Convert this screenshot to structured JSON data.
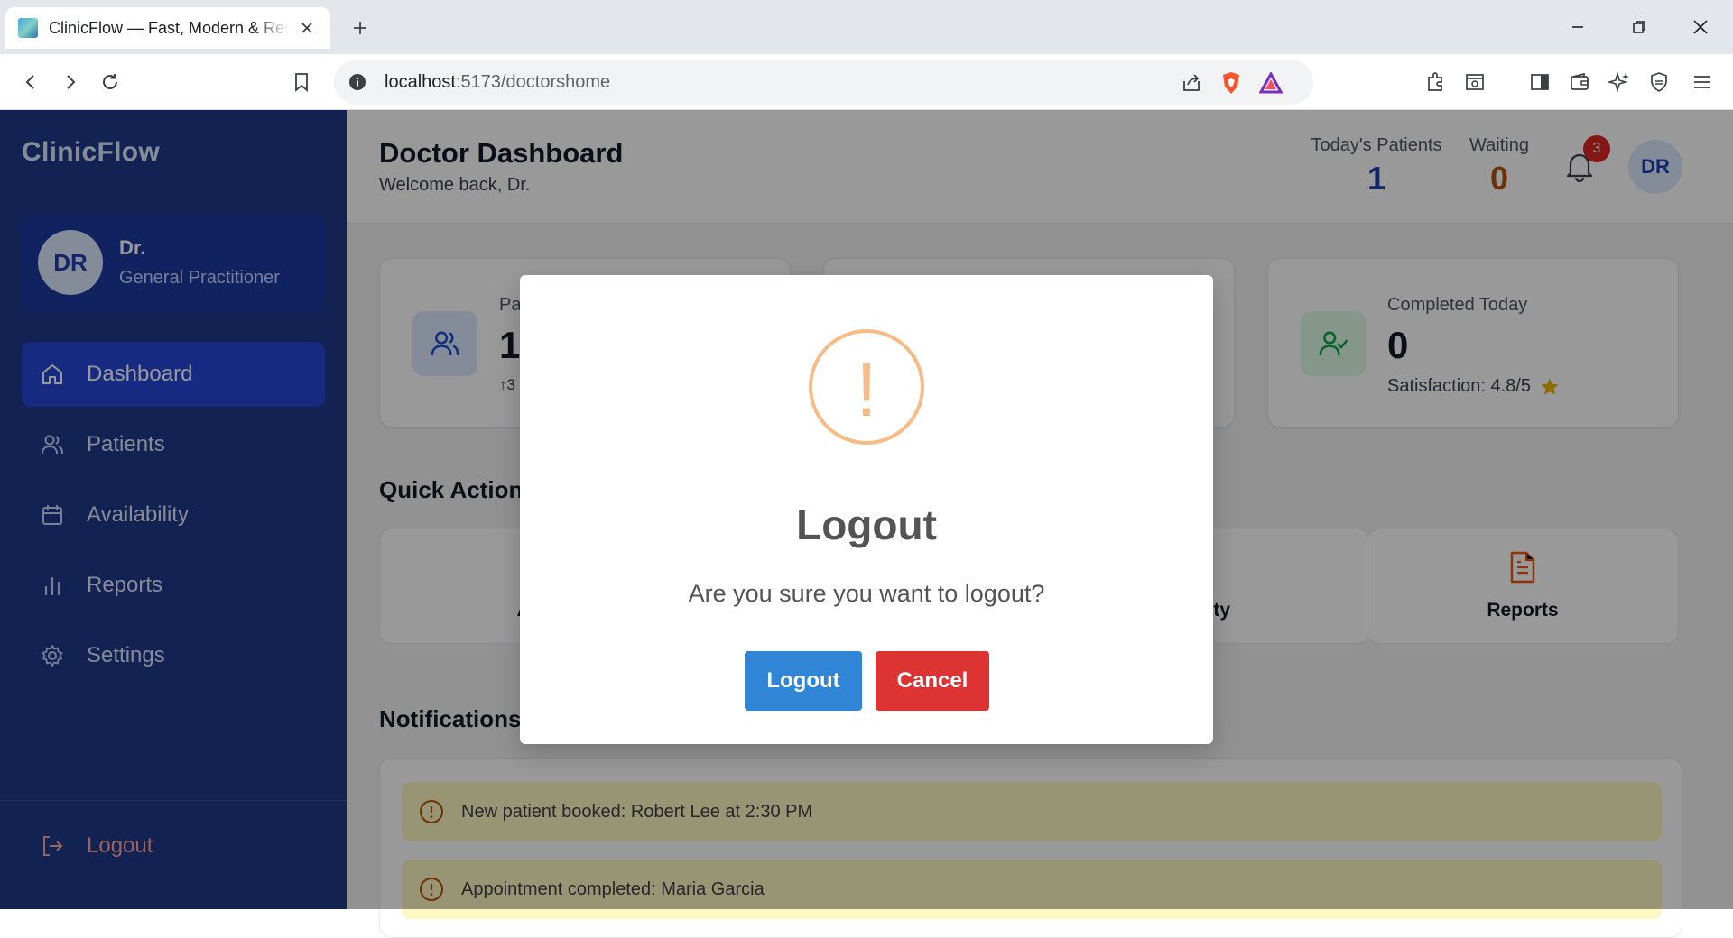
{
  "browser": {
    "tab_title": "ClinicFlow — Fast, Modern & Responsive",
    "url_host": "localhost",
    "url_path": ":5173/doctorshome"
  },
  "sidebar": {
    "brand": "ClinicFlow",
    "profile": {
      "initials": "DR",
      "name": "Dr.",
      "role": "General Practitioner"
    },
    "items": [
      {
        "label": "Dashboard",
        "icon": "home-icon",
        "active": true
      },
      {
        "label": "Patients",
        "icon": "users-icon",
        "active": false
      },
      {
        "label": "Availability",
        "icon": "calendar-icon",
        "active": false
      },
      {
        "label": "Reports",
        "icon": "bar-chart-icon",
        "active": false
      },
      {
        "label": "Settings",
        "icon": "gear-icon",
        "active": false
      }
    ],
    "logout_label": "Logout"
  },
  "header": {
    "title": "Doctor Dashboard",
    "subtitle": "Welcome back, Dr.",
    "todays_patients_label": "Today's Patients",
    "todays_patients_value": "1",
    "waiting_label": "Waiting",
    "waiting_value": "0",
    "notification_count": "3",
    "avatar_initials": "DR"
  },
  "stats": {
    "card1": {
      "label": "Pa",
      "value": "1",
      "sub": "↑3"
    },
    "card3": {
      "label": "Completed Today",
      "value": "0",
      "sub": "Satisfaction: 4.8/5"
    }
  },
  "quick_actions": {
    "title": "Quick Action",
    "items": [
      {
        "label": "Add"
      },
      {
        "label": "ility"
      },
      {
        "label": "Reports"
      }
    ]
  },
  "notifications": {
    "title": "Notifications",
    "items": [
      "New patient booked: Robert Lee at 2:30 PM",
      "Appointment completed: Maria Garcia"
    ]
  },
  "modal": {
    "icon": "warning-icon",
    "icon_glyph": "!",
    "title": "Logout",
    "text": "Are you sure you want to logout?",
    "confirm_label": "Logout",
    "cancel_label": "Cancel"
  },
  "colors": {
    "sidebar_bg": "#1e3a8a",
    "active_nav": "#2347d6",
    "confirm_button": "#3085d6",
    "cancel_button": "#dd3333",
    "warning_icon": "#f8bb86"
  }
}
